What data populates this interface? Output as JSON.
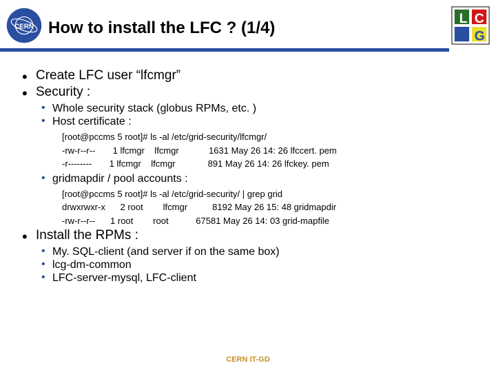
{
  "header": {
    "title": "How to install the LFC ? (1/4)"
  },
  "bullets": {
    "b1": "Create LFC user “lfcmgr”",
    "b2": "Security :",
    "b2a": "Whole security stack (globus RPMs, etc. )",
    "b2b": "Host certificate :",
    "code1_l1": "[root@pccms 5 root]# ls -al /etc/grid-security/lfcmgr/",
    "code1_l2": "-rw-r--r--       1 lfcmgr    lfcmgr            1631 May 26 14: 26 lfccert. pem",
    "code1_l3": "-r--------       1 lfcmgr    lfcmgr             891 May 26 14: 26 lfckey. pem",
    "b2c": "gridmapdir / pool accounts :",
    "code2_l1": "[root@pccms 5 root]# ls -al /etc/grid-security/ | grep grid",
    "code2_l2": "drwxrwxr-x      2 root        lfcmgr          8192 May 26 15: 48 gridmapdir",
    "code2_l3": "-rw-r--r--      1 root        root           67581 May 26 14: 03 grid-mapfile",
    "b3": "Install the RPMs :",
    "b3a": "My. SQL-client (and server if on the same box)",
    "b3b": "lcg-dm-common",
    "b3c": "LFC-server-mysql, LFC-client"
  },
  "footer": "CERN IT-GD"
}
